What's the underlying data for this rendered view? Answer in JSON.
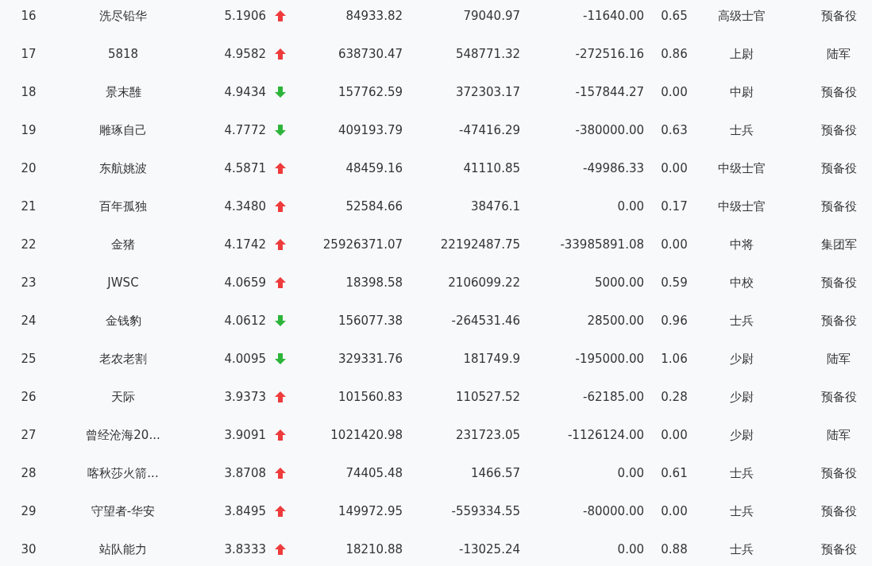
{
  "rows": [
    {
      "rank": "16",
      "name": "洗尽铅华",
      "score": "5.1906",
      "kind": "up",
      "column_4": "84933.82",
      "column_5": "79040.97",
      "column_6": "-11640.00",
      "column_7": "0.65",
      "title": "高级士官",
      "column_9": "预备役"
    },
    {
      "rank": "17",
      "name": "5818",
      "score": "4.9582",
      "kind": "up",
      "column_4": "638730.47",
      "column_5": "548771.32",
      "column_6": "-272516.16",
      "column_7": "0.86",
      "title": "上尉",
      "column_9": "陆军"
    },
    {
      "rank": "18",
      "name": "景末雝",
      "score": "4.9434",
      "kind": "down",
      "column_4": "157762.59",
      "column_5": "372303.17",
      "column_6": "-157844.27",
      "column_7": "0.00",
      "title": "中尉",
      "column_9": "预备役"
    },
    {
      "rank": "19",
      "name": "雕琢自己",
      "score": "4.7772",
      "kind": "down",
      "column_4": "409193.79",
      "column_5": "-47416.29",
      "column_6": "-380000.00",
      "column_7": "0.63",
      "title": "士兵",
      "column_9": "预备役"
    },
    {
      "rank": "20",
      "name": "东航姚波",
      "score": "4.5871",
      "kind": "up",
      "column_4": "48459.16",
      "column_5": "41110.85",
      "column_6": "-49986.33",
      "column_7": "0.00",
      "title": "中级士官",
      "column_9": "预备役"
    },
    {
      "rank": "21",
      "name": "百年孤独",
      "score": "4.3480",
      "kind": "up",
      "column_4": "52584.66",
      "column_5": "38476.1",
      "column_6": "0.00",
      "column_7": "0.17",
      "title": "中级士官",
      "column_9": "预备役"
    },
    {
      "rank": "22",
      "name": "金猪",
      "score": "4.1742",
      "kind": "up",
      "column_4": "25926371.07",
      "column_5": "22192487.75",
      "column_6": "-33985891.08",
      "column_7": "0.00",
      "title": "中将",
      "column_9": "集团军"
    },
    {
      "rank": "23",
      "name": "JWSC",
      "score": "4.0659",
      "kind": "up",
      "column_4": "18398.58",
      "column_5": "2106099.22",
      "column_6": "5000.00",
      "column_7": "0.59",
      "title": "中校",
      "column_9": "预备役"
    },
    {
      "rank": "24",
      "name": "金钱豹",
      "score": "4.0612",
      "kind": "down",
      "column_4": "156077.38",
      "column_5": "-264531.46",
      "column_6": "28500.00",
      "column_7": "0.96",
      "title": "士兵",
      "column_9": "预备役"
    },
    {
      "rank": "25",
      "name": "老农老割",
      "score": "4.0095",
      "kind": "down",
      "column_4": "329331.76",
      "column_5": "181749.9",
      "column_6": "-195000.00",
      "column_7": "1.06",
      "title": "少尉",
      "column_9": "陆军"
    },
    {
      "rank": "26",
      "name": "天际",
      "score": "3.9373",
      "kind": "up",
      "column_4": "101560.83",
      "column_5": "110527.52",
      "column_6": "-62185.00",
      "column_7": "0.28",
      "title": "少尉",
      "column_9": "预备役"
    },
    {
      "rank": "27",
      "name": "曾经沧海20...",
      "score": "3.9091",
      "kind": "up",
      "column_4": "1021420.98",
      "column_5": "231723.05",
      "column_6": "-1126124.00",
      "column_7": "0.00",
      "title": "少尉",
      "column_9": "陆军"
    },
    {
      "rank": "28",
      "name": "喀秋莎火箭...",
      "score": "3.8708",
      "kind": "up",
      "column_4": "74405.48",
      "column_5": "1466.57",
      "column_6": "0.00",
      "column_7": "0.61",
      "title": "士兵",
      "column_9": "预备役"
    },
    {
      "rank": "29",
      "name": "守望者-华安",
      "score": "3.8495",
      "kind": "up",
      "column_4": "149972.95",
      "column_5": "-559334.55",
      "column_6": "-80000.00",
      "column_7": "0.00",
      "title": "士兵",
      "column_9": "预备役"
    },
    {
      "rank": "30",
      "name": "站队能力",
      "score": "3.8333",
      "kind": "up",
      "column_4": "18210.88",
      "column_5": "-13025.24",
      "column_6": "0.00",
      "column_7": "0.88",
      "title": "士兵",
      "column_9": "预备役"
    }
  ]
}
